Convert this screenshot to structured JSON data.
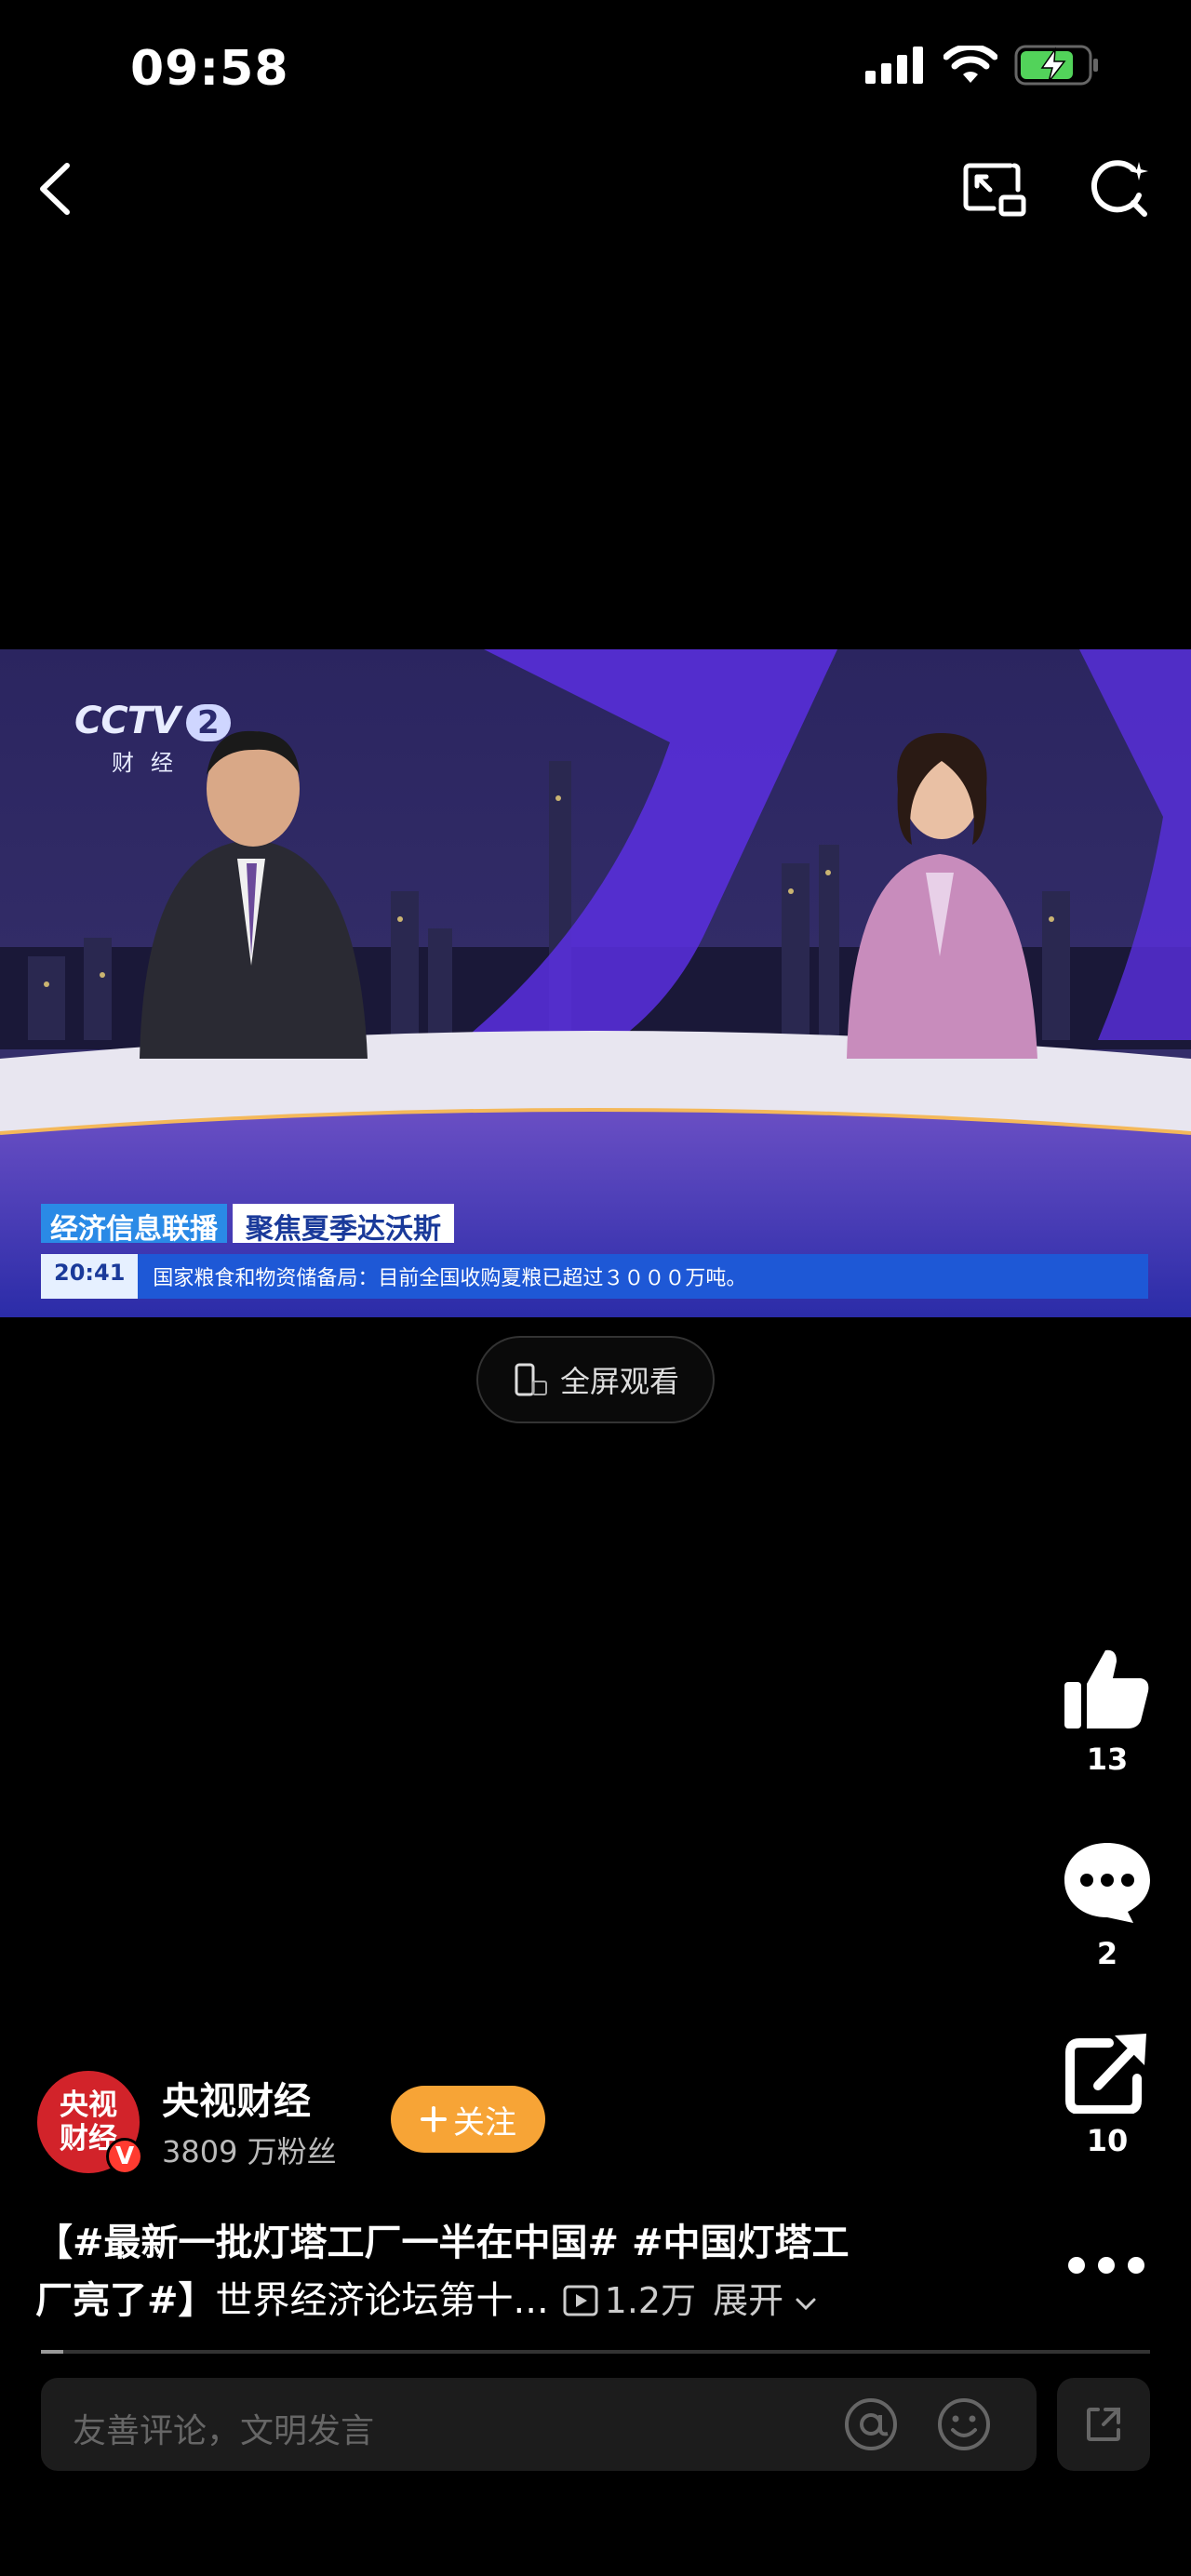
{
  "status_bar": {
    "time": "09:58",
    "battery_state": "charging"
  },
  "icons": {
    "back": "back-chevron-icon",
    "pip": "picture-in-picture-icon",
    "search": "ai-search-icon",
    "like": "thumbs-up-icon",
    "comment": "comment-bubble-icon",
    "share": "share-icon",
    "more": "more-dots-icon"
  },
  "video": {
    "channel_logo": "CCTV 2",
    "channel_sub": "财经",
    "program": "经济信息联播",
    "topic": "聚焦夏季达沃斯",
    "ticker_time": "20:41",
    "ticker_text": "国家粮食和物资储备局：目前全国收购夏粮已超过３０００万吨。"
  },
  "fullscreen_button": {
    "label": "全屏观看"
  },
  "actions": {
    "like_count": "13",
    "comment_count": "2",
    "share_count": "10"
  },
  "author": {
    "avatar_text_top": "央视",
    "avatar_text_bottom": "财经",
    "badge": "V",
    "name": "央视财经",
    "fans": "3809 万粉丝",
    "follow_label": "关注"
  },
  "caption": {
    "line1": "【#最新一批灯塔工厂一半在中国# #中国灯塔工",
    "line2_bold": "厂亮了#】",
    "line2_rest": "世界经济论坛第十...",
    "views": "1.2万",
    "expand": "展开"
  },
  "progress": {
    "fraction": 0.02
  },
  "comment_input": {
    "placeholder": "友善评论，文明发言"
  },
  "colors": {
    "follow": "#f7a436",
    "avatar": "#d2232a",
    "background": "#000000"
  }
}
